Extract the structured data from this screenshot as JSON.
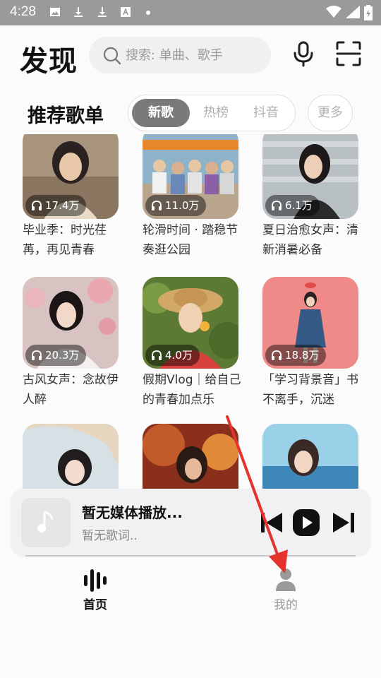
{
  "status_bar": {
    "time": "4:28"
  },
  "header": {
    "title": "发现",
    "search_placeholder": "搜索: 单曲、歌手"
  },
  "section": {
    "title": "推荐歌单",
    "tabs": [
      {
        "label": "新歌",
        "active": true
      },
      {
        "label": "热榜",
        "active": false
      },
      {
        "label": "抖音",
        "active": false
      }
    ],
    "more_label": "更多"
  },
  "playlists": [
    {
      "play_count": "17.4万",
      "title": "毕业季：时光荏苒，再见青春"
    },
    {
      "play_count": "11.0万",
      "title": "轮滑时间 · 踏稳节奏逛公园"
    },
    {
      "play_count": "6.1万",
      "title": "夏日治愈女声：清新消暑必备"
    },
    {
      "play_count": "20.3万",
      "title": "古风女声：念故伊人醉"
    },
    {
      "play_count": "4.0万",
      "title": "假期Vlog｜给自己的青春加点乐"
    },
    {
      "play_count": "18.8万",
      "title": "「学习背景音」书不离手，沉迷"
    },
    {
      "play_count": "",
      "title": ""
    },
    {
      "play_count": "",
      "title": ""
    },
    {
      "play_count": "",
      "title": ""
    }
  ],
  "mini_player": {
    "title": "暂无媒体播放...",
    "subtitle": "暂无歌词.."
  },
  "bottom_nav": [
    {
      "label": "首页",
      "active": true
    },
    {
      "label": "我的",
      "active": false
    }
  ],
  "colors": {
    "status_bar_bg": "#9a9a9a",
    "active_tab_bg": "#7a7a7a",
    "annotation_arrow": "#e5322d"
  }
}
